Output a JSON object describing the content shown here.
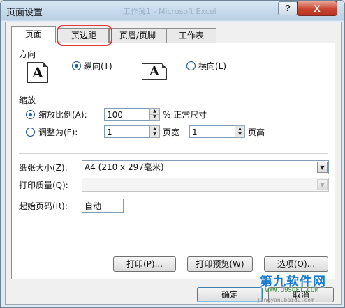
{
  "window": {
    "title": "页面设置",
    "background_title": "工作簿1 - Microsoft Excel",
    "help_label": "?",
    "close_label": "X"
  },
  "tabs": [
    {
      "label": "页面",
      "active": true
    },
    {
      "label": "页边距",
      "active": false,
      "highlighted": true
    },
    {
      "label": "页眉/页脚",
      "active": false
    },
    {
      "label": "工作表",
      "active": false
    }
  ],
  "orientation": {
    "group_label": "方向",
    "portrait_icon": "A",
    "portrait_label": "纵向(T)",
    "portrait_selected": true,
    "landscape_icon": "A",
    "landscape_label": "横向(L)",
    "landscape_selected": false
  },
  "scaling": {
    "group_label": "缩放",
    "adjust_label": "缩放比例(A):",
    "adjust_selected": true,
    "adjust_value": "100",
    "adjust_suffix": "% 正常尺寸",
    "fit_label": "调整为(F):",
    "fit_selected": false,
    "fit_wide_value": "1",
    "fit_wide_suffix": "页宽",
    "fit_tall_value": "1",
    "fit_tall_suffix": "页高"
  },
  "paper_size": {
    "label": "纸张大小(Z):",
    "value": "A4 (210 x 297毫米)"
  },
  "print_quality": {
    "label": "打印质量(Q):",
    "value": ""
  },
  "first_page": {
    "label": "起始页码(R):",
    "value": "自动"
  },
  "buttons": {
    "print": "打印(P)...",
    "print_preview": "打印预览(W)",
    "options": "选项(O)...",
    "ok": "确定",
    "cancel": "取消"
  },
  "watermark": {
    "main": "第九软件网",
    "sub": "WWW.D9SOFT.COM",
    "url": "jingyan.baidu.com"
  }
}
